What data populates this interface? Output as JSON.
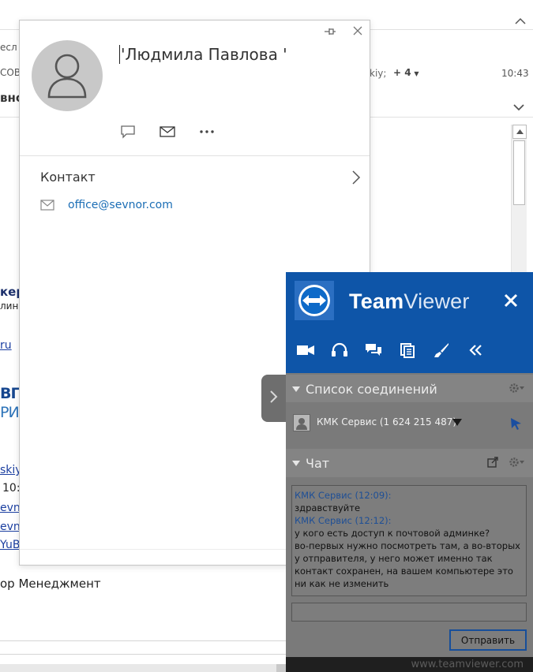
{
  "background": {
    "frag_sender1": "есл",
    "frag_sender2": "СОВ",
    "frag_subject": "вно",
    "frag_recipients": "kiy;",
    "more_recipients": "+ 4",
    "time": "10:43",
    "sig_name_frag": "кер",
    "sig_line2_frag": "лин",
    "link_ru": "ru",
    "logo_frag1": "ВПР",
    "logo_frag2": "РИ",
    "link_frag1": "skiy",
    "time_frag": "10:",
    "link_frag2": "evnc",
    "link_frag3": "evnc",
    "link_frag4": "YuB",
    "company_frag": "ор Менеджмент"
  },
  "contact_card": {
    "name": "'Людмила Павлова '",
    "section_label": "Контакт",
    "email": "office@sevnor.com",
    "icons": [
      "pin-icon",
      "close-icon",
      "chat-icon",
      "mail-icon",
      "more-icon",
      "chevron-right-icon"
    ]
  },
  "teamviewer": {
    "title_bold": "Team",
    "title_light": "Viewer",
    "connections_header": "Список соединений",
    "connection_name": "КМК Сервис (1 624 215 487)",
    "chat_header": "Чат",
    "chat": [
      {
        "author": "КМК Сервис (12:09):",
        "text": "здравствуйте"
      },
      {
        "author": "КМК Сервис (12:12):",
        "text": "у кого есть доступ к почтовой админке?"
      },
      {
        "author": "",
        "text": "во-первых нужно посмотреть там, а во-вторых у отправителя, у него может именно так контакт сохранен, на вашем компьютере это ни как не изменить"
      }
    ],
    "send_label": "Отправить",
    "footer_url": "www.teamviewer.com",
    "toolbar_icons": [
      "video-icon",
      "headset-icon",
      "chat-icon",
      "files-icon",
      "whiteboard-icon",
      "collapse-icon"
    ],
    "colors": {
      "header_blue": "#0e55a8",
      "panel_gray": "#7a7a7a",
      "author_blue": "#1e4f96"
    }
  }
}
